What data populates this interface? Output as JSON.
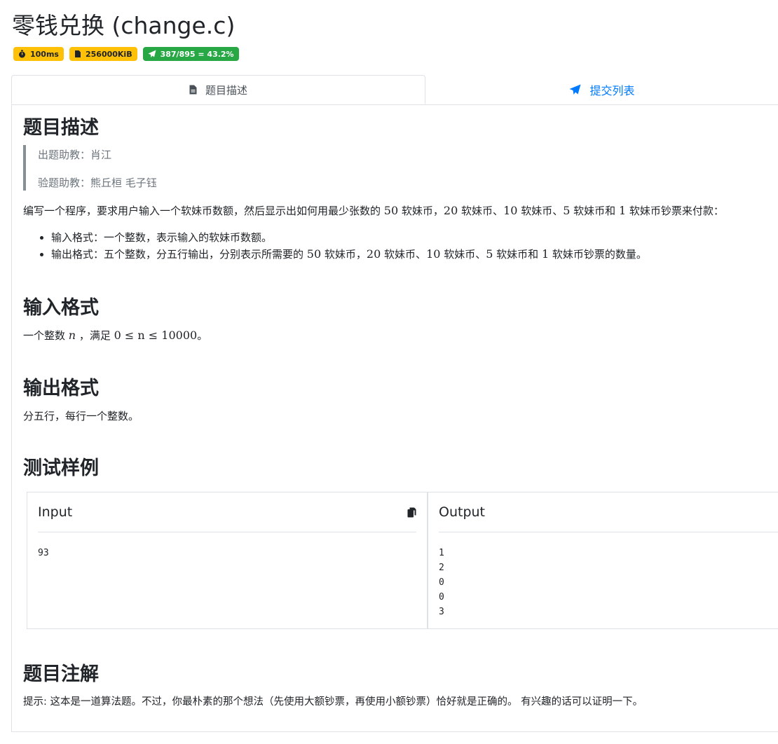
{
  "title": "零钱兑换 (change.c)",
  "badges": {
    "time": "100ms",
    "memory": "256000KiB",
    "ratio": "387/895 = 43.2%"
  },
  "tabs": {
    "description": "题目描述",
    "submissions": "提交列表"
  },
  "problem": {
    "heading": "题目描述",
    "quote": [
      "出题助教：肖江",
      "验题助教：熊丘桓 毛子钰"
    ],
    "intro_parts": [
      "编写一个程序，要求用户输入一个软妹币数额，然后显示出如何用最少张数的 ",
      "50",
      " 软妹币，",
      "20",
      " 软妹币、",
      "10",
      " 软妹币、",
      "5",
      " 软妹币和 ",
      "1",
      " 软妹币钞票来付款："
    ],
    "bullets": [
      [
        "输入格式：一个整数，表示输入的软妹币数额。"
      ],
      [
        "输出格式：五个整数，分五行输出，分别表示所需要的 ",
        "50",
        " 软妹币，",
        "20",
        " 软妹币、",
        "10",
        " 软妹币、",
        "5",
        " 软妹币和 ",
        "1",
        " 软妹币钞票的数量。"
      ]
    ]
  },
  "input_format": {
    "heading": "输入格式",
    "parts": [
      "一个整数 ",
      "n",
      " ，满足 ",
      "0 ≤ n ≤ 10000",
      "。"
    ]
  },
  "output_format": {
    "heading": "输出格式",
    "text": "分五行，每行一个整数。"
  },
  "samples": {
    "heading": "测试样例",
    "input_label": "Input",
    "input_value": "93",
    "output_label": "Output",
    "output_value": "1\n2\n0\n0\n3"
  },
  "notes": {
    "heading": "题目注解",
    "text": "提示: 这本是一道算法题。不过，你最朴素的那个想法（先使用大额钞票，再使用小额钞票）恰好就是正确的。 有兴趣的话可以证明一下。"
  },
  "colors": {
    "accent": "#007bff",
    "badge_yellow": "#ffc107",
    "badge_green": "#28a745"
  }
}
